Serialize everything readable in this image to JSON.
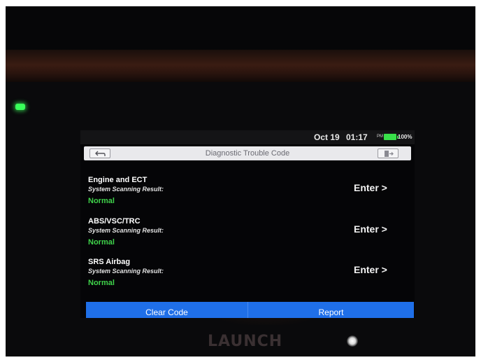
{
  "status_bar": {
    "date": "Oct 19",
    "time": "01:17",
    "ampm": "PM",
    "battery": "100%",
    "battery_color": "#39e04a"
  },
  "title_bar": {
    "title": "Diagnostic Trouble Code",
    "back_icon": "back-arrow-icon",
    "exit_icon": "exit-icon"
  },
  "systems": [
    {
      "name": "Engine and ECT",
      "scan_label": "System Scanning Result:",
      "result": "Normal",
      "enter_label": "Enter >"
    },
    {
      "name": "ABS/VSC/TRC",
      "scan_label": "System Scanning Result:",
      "result": "Normal",
      "enter_label": "Enter >"
    },
    {
      "name": "SRS Airbag",
      "scan_label": "System Scanning Result:",
      "result": "Normal",
      "enter_label": "Enter >"
    }
  ],
  "actions": {
    "clear_code": "Clear Code",
    "report": "Report",
    "accent_color": "#1f6fe8"
  },
  "device": {
    "brand": "LAUNCH",
    "status_led_color": "#39ff5a"
  },
  "colors": {
    "normal_status": "#3fd24a",
    "screen_background": "#050507"
  }
}
